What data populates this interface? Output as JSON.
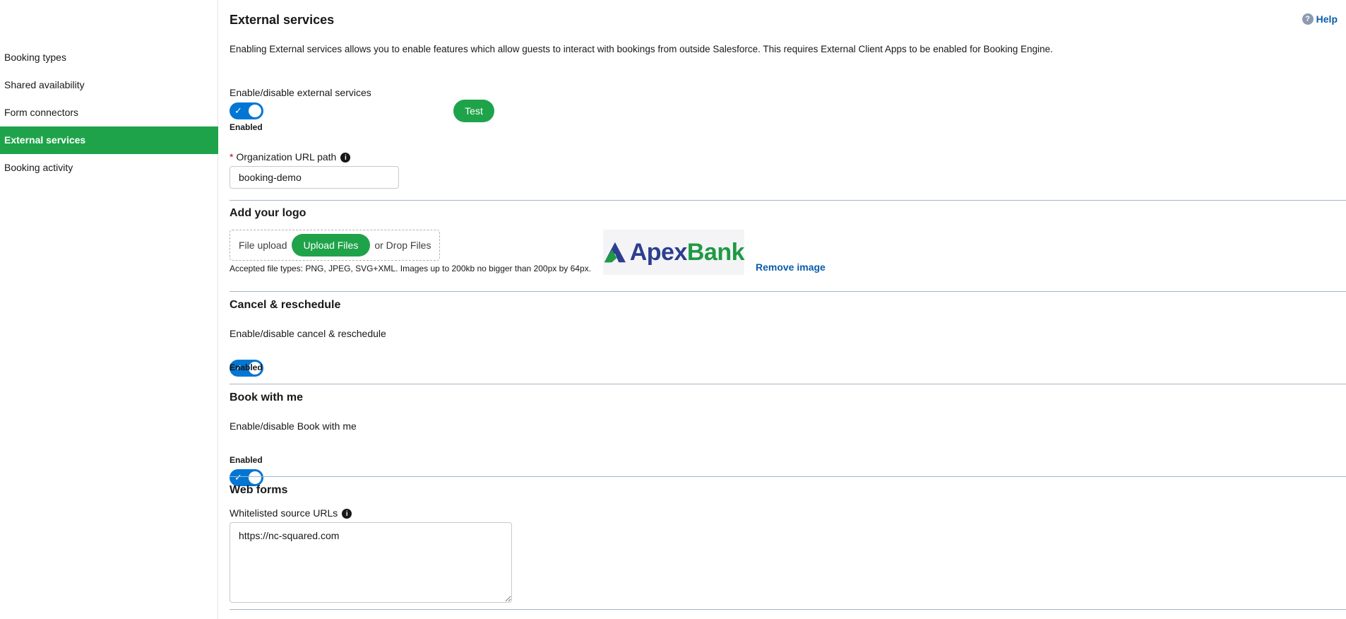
{
  "sidebar": {
    "items": [
      {
        "label": "Booking types"
      },
      {
        "label": "Shared availability"
      },
      {
        "label": "Form connectors"
      },
      {
        "label": "External services",
        "active": true
      },
      {
        "label": "Booking activity"
      }
    ]
  },
  "header": {
    "title": "External services",
    "help_label": "Help",
    "description": "Enabling External services allows you to enable features which allow guests to interact with bookings from outside Salesforce. This requires External Client Apps to be enabled for Booking Engine."
  },
  "external_services": {
    "toggle_label": "Enable/disable external services",
    "status": "Enabled",
    "enabled": true,
    "test_label": "Test",
    "required_mark": "*",
    "org_url_label": "Organization URL path",
    "org_url_value": "booking-demo"
  },
  "logo": {
    "title": "Add your logo",
    "file_upload_label": "File upload",
    "upload_button": "Upload Files",
    "drop_label": "or Drop Files",
    "accepted_text": "Accepted file types: PNG, JPEG, SVG+XML. Images up to 200kb no bigger than 200px by 64px.",
    "logo_text_apex": "Apex",
    "logo_text_bank": "Bank",
    "remove_label": "Remove image"
  },
  "cancel_reschedule": {
    "title": "Cancel & reschedule",
    "toggle_label": "Enable/disable cancel & reschedule",
    "status": "Enabled",
    "enabled": true
  },
  "book_with_me": {
    "title": "Book with me",
    "toggle_label": "Enable/disable Book with me",
    "status": "Enabled",
    "enabled": true
  },
  "web_forms": {
    "title": "Web forms",
    "whitelist_label": "Whitelisted source URLs",
    "whitelist_value": "https://nc-squared.com"
  },
  "colors": {
    "accent_green": "#1fa34a",
    "toggle_blue": "#0176d3",
    "link_blue": "#0b5cab",
    "required_red": "#ba0517"
  },
  "icons": {
    "help": "question-circle-icon",
    "info": "info-icon",
    "check": "checkmark-icon",
    "logo": "apexbank-logo-mark"
  }
}
